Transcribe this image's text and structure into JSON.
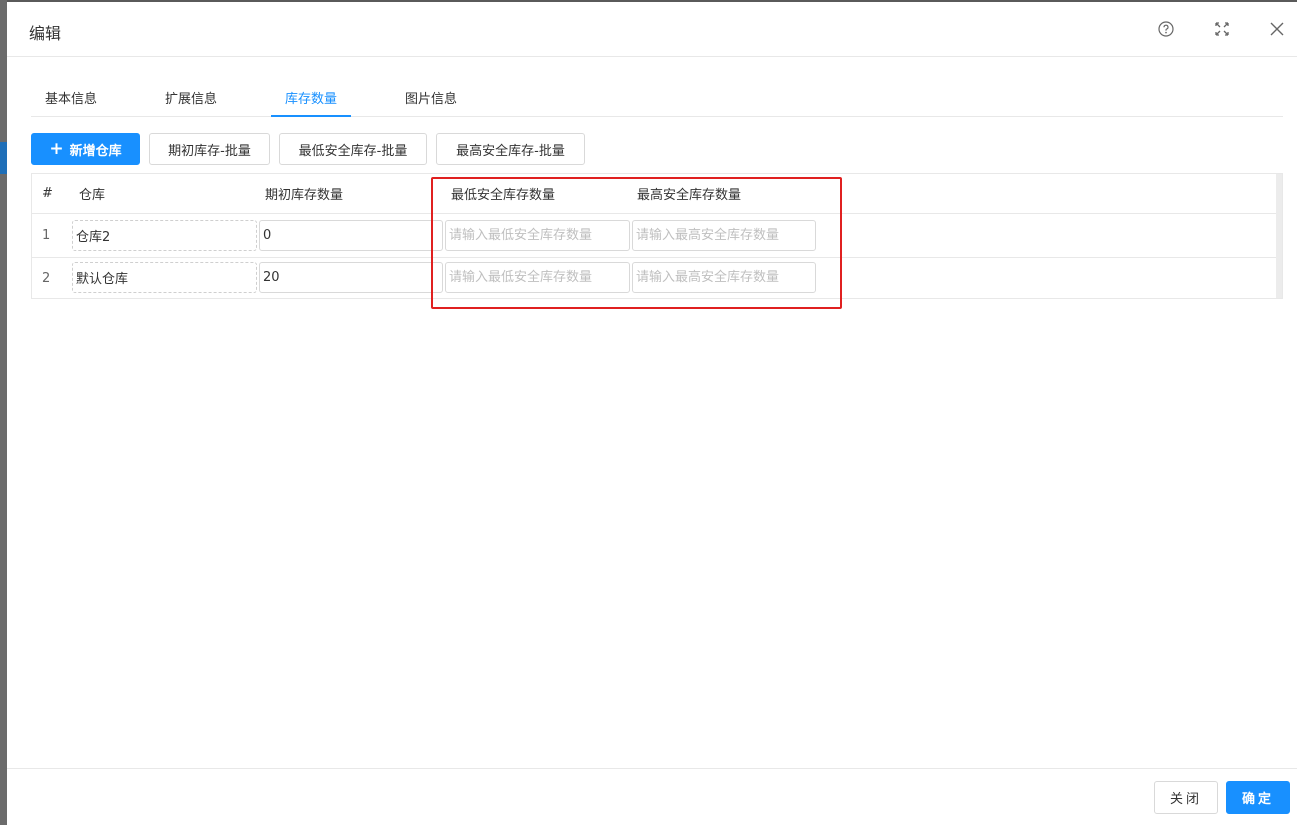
{
  "modal": {
    "title": "编辑",
    "icons": {
      "help": "help-circle-icon",
      "fullscreen": "fullscreen-icon",
      "close": "close-icon"
    }
  },
  "tabs": [
    {
      "label": "基本信息",
      "active": false
    },
    {
      "label": "扩展信息",
      "active": false
    },
    {
      "label": "库存数量",
      "active": true
    },
    {
      "label": "图片信息",
      "active": false
    }
  ],
  "toolbar": {
    "add_warehouse": "新增仓库",
    "batch_initial": "期初库存-批量",
    "batch_min": "最低安全库存-批量",
    "batch_max": "最高安全库存-批量"
  },
  "grid": {
    "columns": {
      "index": "#",
      "warehouse": "仓库",
      "initial": "期初库存数量",
      "min_safety": "最低安全库存数量",
      "max_safety": "最高安全库存数量"
    },
    "rows": [
      {
        "index": "1",
        "warehouse": "仓库2",
        "initial": "0",
        "min_safety": "",
        "max_safety": ""
      },
      {
        "index": "2",
        "warehouse": "默认仓库",
        "initial": "20",
        "min_safety": "",
        "max_safety": ""
      }
    ],
    "placeholders": {
      "min_safety": "请输入最低安全库存数量",
      "max_safety": "请输入最高安全库存数量"
    }
  },
  "footer": {
    "close_label": "关闭",
    "ok_label": "确定"
  },
  "colors": {
    "primary": "#1890ff",
    "highlight": "#e02020"
  }
}
